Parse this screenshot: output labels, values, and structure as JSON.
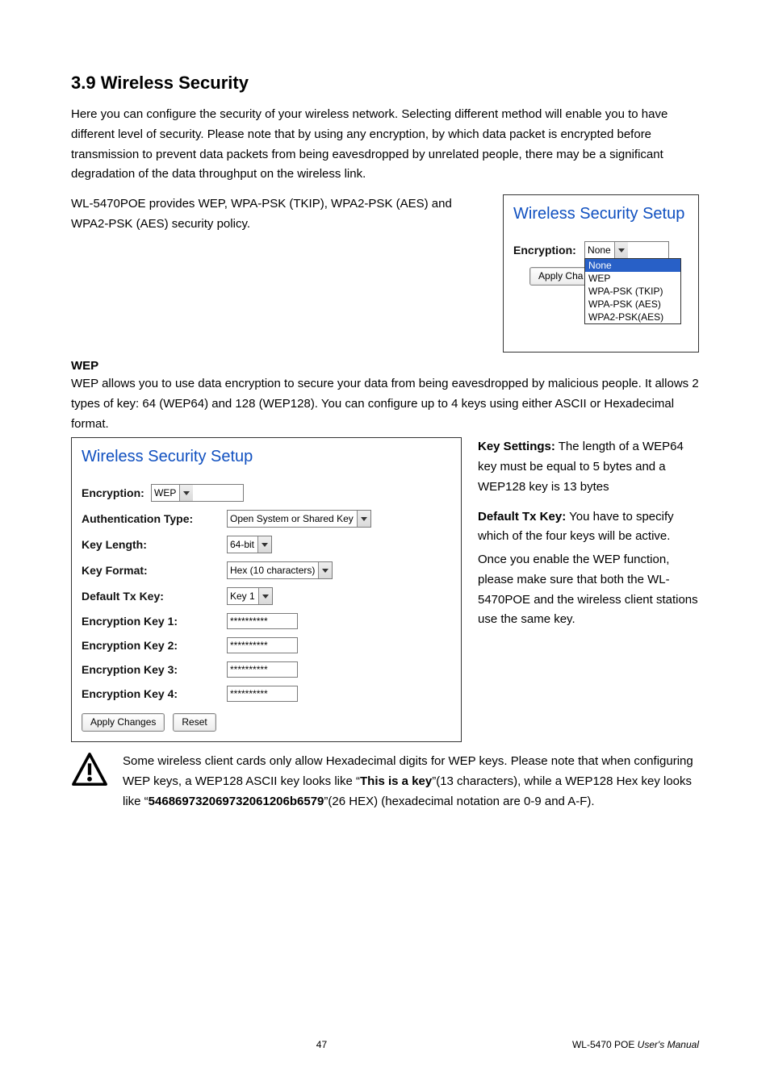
{
  "heading": "3.9 Wireless Security",
  "intro": "Here you can configure the security of your wireless network. Selecting different method will enable you to have different level of security.   Please note that by using any encryption, by which data packet is encrypted before transmission to prevent data packets from being eavesdropped by unrelated people, there may be a significant degradation of the data throughput on the wireless link.",
  "policy": "WL-5470POE provides WEP, WPA-PSK (TKIP), WPA2-PSK (AES) and WPA2-PSK (AES) security policy.",
  "fig1": {
    "title": "Wireless Security Setup",
    "encryption_label": "Encryption:",
    "encryption_value": "None",
    "apply_btn": "Apply Cha",
    "options": [
      "None",
      "WEP",
      "WPA-PSK (TKIP)",
      "WPA-PSK (AES)",
      "WPA2-PSK(AES)"
    ]
  },
  "wep": {
    "h": "WEP",
    "p1": "WEP allows you to use data encryption to secure your data from being eavesdropped by malicious people. It allows 2 types of key: 64 (WEP64) and 128 (WEP128). You can configure up to 4 keys using either ASCII or Hexadecimal format.",
    "key_settings_label": "Key Settings:",
    "key_settings_text": " The length of a WEP64 key must be equal to 5 bytes and a WEP128 key is 13 bytes",
    "default_tx_label": "Default Tx Key:",
    "default_tx_text": " You have to specify which of the four keys will be active.",
    "note2": "Once you enable the WEP function, please make sure that both the WL-5470POE and the wireless client stations use the same key."
  },
  "fig2": {
    "title": "Wireless Security Setup",
    "encryption_label": "Encryption:",
    "encryption_value": "WEP",
    "auth_label": "Authentication Type:",
    "auth_value": "Open System or Shared Key",
    "keylen_label": "Key Length:",
    "keylen_value": "64-bit",
    "keyfmt_label": "Key Format:",
    "keyfmt_value": "Hex (10 characters)",
    "deftx_label": "Default Tx Key:",
    "deftx_value": "Key 1",
    "k1_label": "Encryption Key 1:",
    "k2_label": "Encryption Key 2:",
    "k3_label": "Encryption Key 3:",
    "k4_label": "Encryption Key 4:",
    "key_mask": "**********",
    "apply_btn": "Apply Changes",
    "reset_btn": "Reset"
  },
  "warn": {
    "p_a": "Some wireless client cards only allow Hexadecimal digits for WEP keys. Please note that when configuring WEP keys, a WEP128 ASCII key looks like “",
    "bold_a": "This is a key",
    "p_b": "”(13 characters), while a WEP128 Hex key looks like “",
    "bold_b": "546869732069732061206b6579",
    "p_c": "”(26 HEX) (hexadecimal notation are 0-9 and A-F)."
  },
  "footer": {
    "page": "47",
    "product": "WL-5470 POE ",
    "manual": "User's Manual"
  }
}
